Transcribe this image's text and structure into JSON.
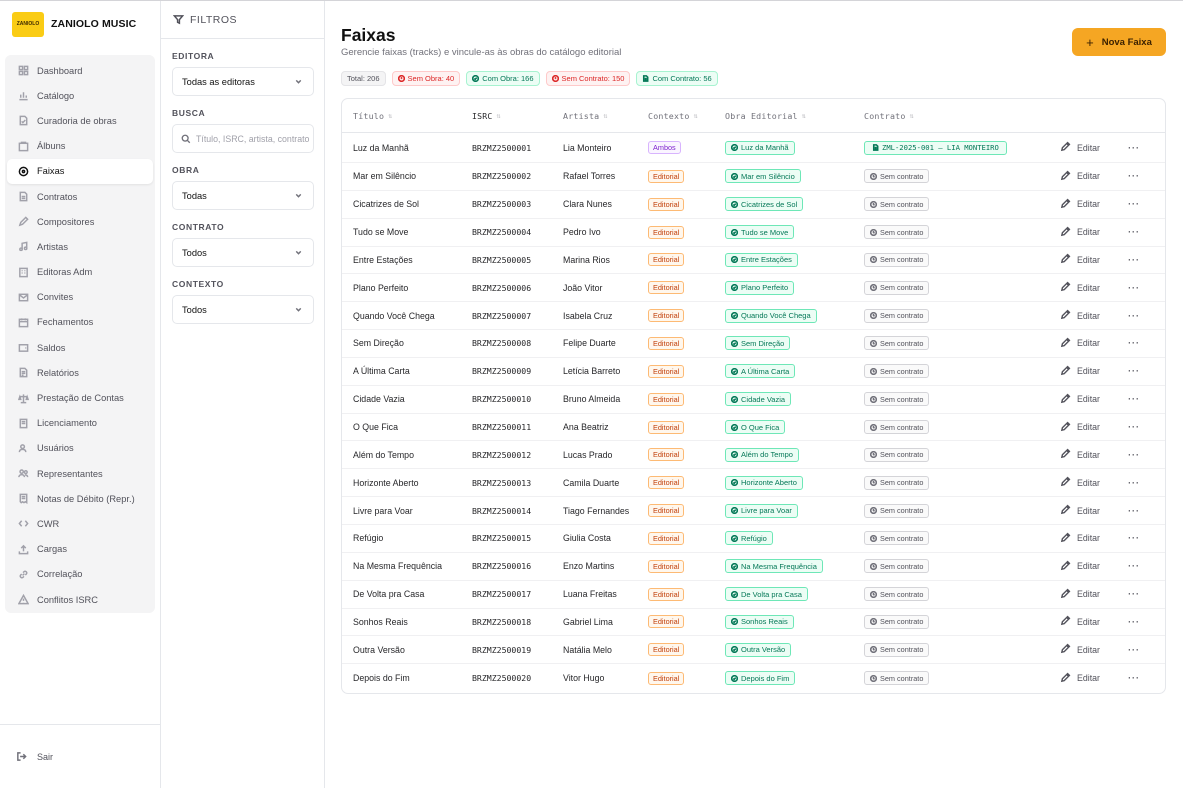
{
  "brand": {
    "name": "ZANIOLO MUSIC",
    "logo_text": "ZANIOLO"
  },
  "sidebar": {
    "items": [
      {
        "label": "Dashboard",
        "icon": "grid-icon",
        "active": false
      },
      {
        "label": "Catálogo",
        "icon": "chart-icon",
        "active": false
      },
      {
        "label": "Curadoria de obras",
        "icon": "doc-check-icon",
        "active": false
      },
      {
        "label": "Álbuns",
        "icon": "album-icon",
        "active": false
      },
      {
        "label": "Faixas",
        "icon": "disc-icon",
        "active": true
      },
      {
        "label": "Contratos",
        "icon": "file-icon",
        "active": false
      },
      {
        "label": "Compositores",
        "icon": "pen-icon",
        "active": false
      },
      {
        "label": "Artistas",
        "icon": "music-icon",
        "active": false
      },
      {
        "label": "Editoras Adm",
        "icon": "building-icon",
        "active": false
      },
      {
        "label": "Convites",
        "icon": "mail-icon",
        "active": false
      },
      {
        "label": "Fechamentos",
        "icon": "calendar-icon",
        "active": false
      },
      {
        "label": "Saldos",
        "icon": "wallet-icon",
        "active": false
      },
      {
        "label": "Relatórios",
        "icon": "report-icon",
        "active": false
      },
      {
        "label": "Prestação de Contas",
        "icon": "scale-icon",
        "active": false
      },
      {
        "label": "Licenciamento",
        "icon": "license-icon",
        "active": false
      },
      {
        "label": "Usuários",
        "icon": "users-icon",
        "active": false
      },
      {
        "label": "Representantes",
        "icon": "user-group-icon",
        "active": false
      },
      {
        "label": "Notas de Débito (Repr.)",
        "icon": "receipt-icon",
        "active": false
      },
      {
        "label": "CWR",
        "icon": "code-icon",
        "active": false
      },
      {
        "label": "Cargas",
        "icon": "upload-icon",
        "active": false
      },
      {
        "label": "Correlação",
        "icon": "link-icon",
        "active": false
      },
      {
        "label": "Conflitos ISRC",
        "icon": "warning-icon",
        "active": false
      }
    ],
    "logout_label": "Sair"
  },
  "filters": {
    "title": "FILTROS",
    "editora": {
      "label": "EDITORA",
      "value": "Todas as editoras"
    },
    "busca": {
      "label": "BUSCA",
      "placeholder": "Título, ISRC, artista, contrato"
    },
    "obra": {
      "label": "OBRA",
      "value": "Todas"
    },
    "contrato": {
      "label": "CONTRATO",
      "value": "Todos"
    },
    "contexto": {
      "label": "CONTEXTO",
      "value": "Todos"
    }
  },
  "page": {
    "title": "Faixas",
    "subtitle": "Gerencie faixas (tracks) e vincule-as às obras do catálogo editorial",
    "new_button": "Nova Faixa"
  },
  "stats": {
    "total": "Total: 206",
    "sem_obra": "Sem Obra: 40",
    "com_obra": "Com Obra: 166",
    "sem_contrato": "Sem Contrato: 150",
    "com_contrato": "Com Contrato: 56"
  },
  "table": {
    "headers": [
      "Título",
      "ISRC",
      "Artista",
      "Contexto",
      "Obra Editorial",
      "Contrato"
    ],
    "edit_label": "Editar",
    "more_label": "···",
    "rows": [
      {
        "titulo": "Luz da Manhã",
        "isrc": "BRZMZ2500001",
        "artista": "Lia Monteiro",
        "contexto": "Ambos",
        "obra": "Luz da Manhã",
        "contrato": "ZML-2025-001 — LIA MONTEIRO",
        "has_contract": true
      },
      {
        "titulo": "Mar em Silêncio",
        "isrc": "BRZMZ2500002",
        "artista": "Rafael Torres",
        "contexto": "Editorial",
        "obra": "Mar em Silêncio",
        "contrato": "Sem contrato",
        "has_contract": false
      },
      {
        "titulo": "Cicatrizes de Sol",
        "isrc": "BRZMZ2500003",
        "artista": "Clara Nunes",
        "contexto": "Editorial",
        "obra": "Cicatrizes de Sol",
        "contrato": "Sem contrato",
        "has_contract": false
      },
      {
        "titulo": "Tudo se Move",
        "isrc": "BRZMZ2500004",
        "artista": "Pedro Ivo",
        "contexto": "Editorial",
        "obra": "Tudo se Move",
        "contrato": "Sem contrato",
        "has_contract": false
      },
      {
        "titulo": "Entre Estações",
        "isrc": "BRZMZ2500005",
        "artista": "Marina Rios",
        "contexto": "Editorial",
        "obra": "Entre Estações",
        "contrato": "Sem contrato",
        "has_contract": false
      },
      {
        "titulo": "Plano Perfeito",
        "isrc": "BRZMZ2500006",
        "artista": "João Vitor",
        "contexto": "Editorial",
        "obra": "Plano Perfeito",
        "contrato": "Sem contrato",
        "has_contract": false
      },
      {
        "titulo": "Quando Você Chega",
        "isrc": "BRZMZ2500007",
        "artista": "Isabela Cruz",
        "contexto": "Editorial",
        "obra": "Quando Você Chega",
        "contrato": "Sem contrato",
        "has_contract": false
      },
      {
        "titulo": "Sem Direção",
        "isrc": "BRZMZ2500008",
        "artista": "Felipe Duarte",
        "contexto": "Editorial",
        "obra": "Sem Direção",
        "contrato": "Sem contrato",
        "has_contract": false
      },
      {
        "titulo": "A Última Carta",
        "isrc": "BRZMZ2500009",
        "artista": "Letícia Barreto",
        "contexto": "Editorial",
        "obra": "A Última Carta",
        "contrato": "Sem contrato",
        "has_contract": false
      },
      {
        "titulo": "Cidade Vazia",
        "isrc": "BRZMZ2500010",
        "artista": "Bruno Almeida",
        "contexto": "Editorial",
        "obra": "Cidade Vazia",
        "contrato": "Sem contrato",
        "has_contract": false
      },
      {
        "titulo": "O Que Fica",
        "isrc": "BRZMZ2500011",
        "artista": "Ana Beatriz",
        "contexto": "Editorial",
        "obra": "O Que Fica",
        "contrato": "Sem contrato",
        "has_contract": false
      },
      {
        "titulo": "Além do Tempo",
        "isrc": "BRZMZ2500012",
        "artista": "Lucas Prado",
        "contexto": "Editorial",
        "obra": "Além do Tempo",
        "contrato": "Sem contrato",
        "has_contract": false
      },
      {
        "titulo": "Horizonte Aberto",
        "isrc": "BRZMZ2500013",
        "artista": "Camila Duarte",
        "contexto": "Editorial",
        "obra": "Horizonte Aberto",
        "contrato": "Sem contrato",
        "has_contract": false
      },
      {
        "titulo": "Livre para Voar",
        "isrc": "BRZMZ2500014",
        "artista": "Tiago Fernandes",
        "contexto": "Editorial",
        "obra": "Livre para Voar",
        "contrato": "Sem contrato",
        "has_contract": false
      },
      {
        "titulo": "Refúgio",
        "isrc": "BRZMZ2500015",
        "artista": "Giulia Costa",
        "contexto": "Editorial",
        "obra": "Refúgio",
        "contrato": "Sem contrato",
        "has_contract": false
      },
      {
        "titulo": "Na Mesma Frequência",
        "isrc": "BRZMZ2500016",
        "artista": "Enzo Martins",
        "contexto": "Editorial",
        "obra": "Na Mesma Frequência",
        "contrato": "Sem contrato",
        "has_contract": false
      },
      {
        "titulo": "De Volta pra Casa",
        "isrc": "BRZMZ2500017",
        "artista": "Luana Freitas",
        "contexto": "Editorial",
        "obra": "De Volta pra Casa",
        "contrato": "Sem contrato",
        "has_contract": false
      },
      {
        "titulo": "Sonhos Reais",
        "isrc": "BRZMZ2500018",
        "artista": "Gabriel Lima",
        "contexto": "Editorial",
        "obra": "Sonhos Reais",
        "contrato": "Sem contrato",
        "has_contract": false
      },
      {
        "titulo": "Outra Versão",
        "isrc": "BRZMZ2500019",
        "artista": "Natália Melo",
        "contexto": "Editorial",
        "obra": "Outra Versão",
        "contrato": "Sem contrato",
        "has_contract": false
      },
      {
        "titulo": "Depois do Fim",
        "isrc": "BRZMZ2500020",
        "artista": "Vitor Hugo",
        "contexto": "Editorial",
        "obra": "Depois do Fim",
        "contrato": "Sem contrato",
        "has_contract": false
      }
    ]
  },
  "colors": {
    "accent": "#f5a623",
    "logo": "#facc15",
    "green": "#047857",
    "red": "#dc2626",
    "orange": "#c2410c",
    "purple": "#7e22ce"
  }
}
